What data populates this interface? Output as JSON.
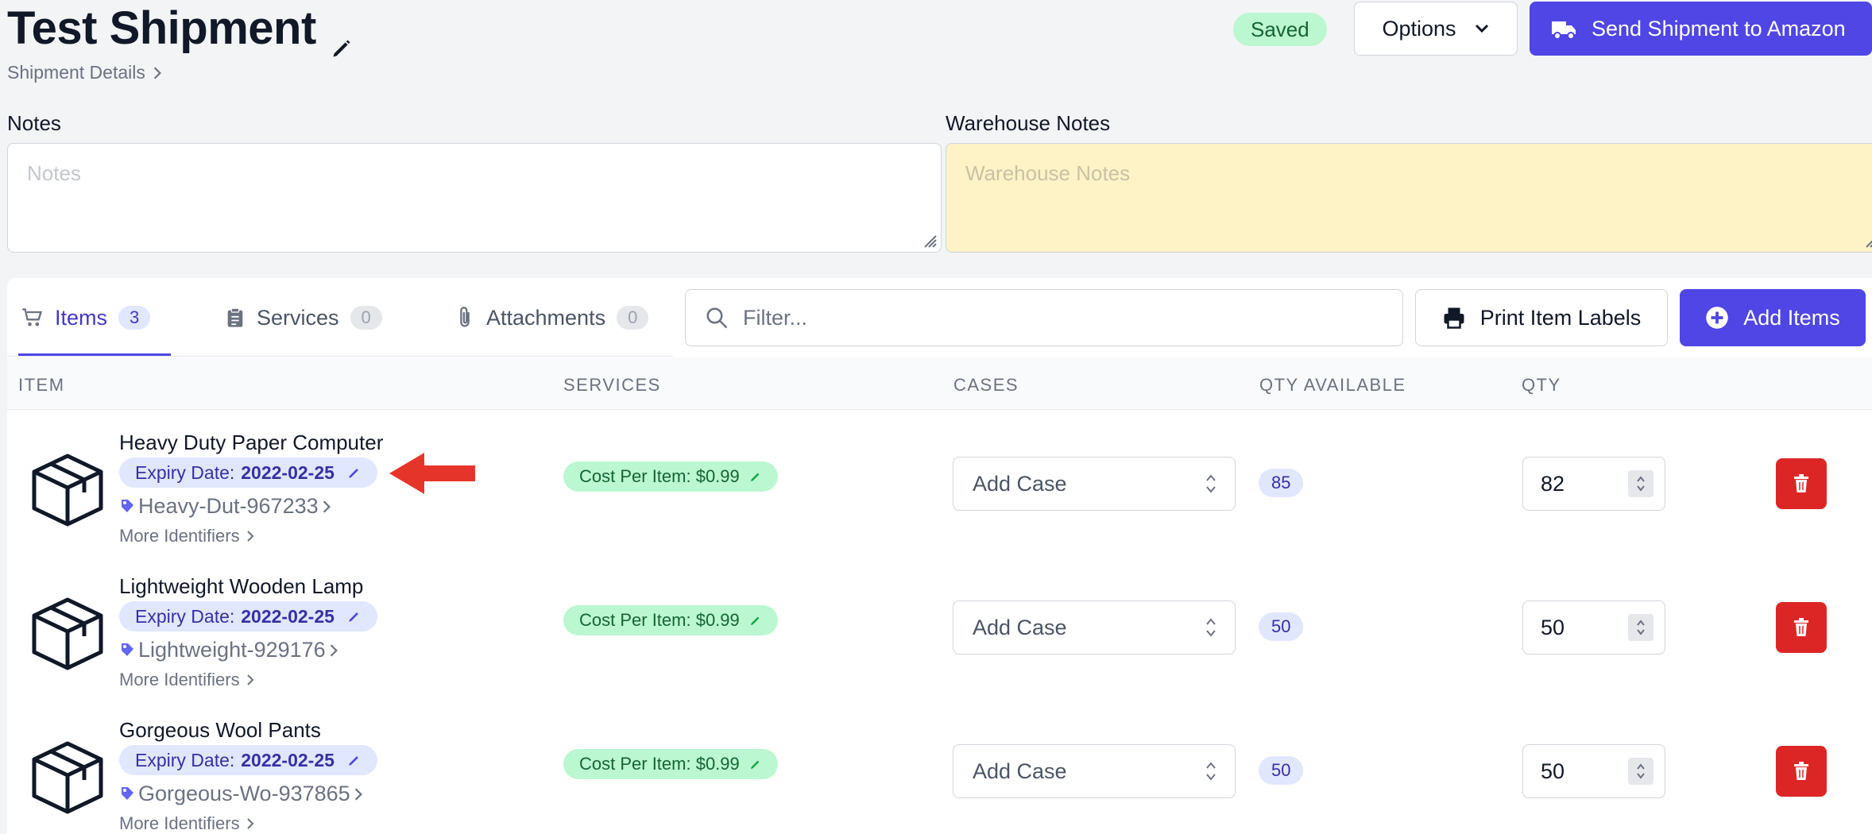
{
  "header": {
    "title": "Test Shipment",
    "breadcrumb": "Shipment Details",
    "status": "Saved",
    "options_label": "Options",
    "send_label": "Send Shipment to Amazon"
  },
  "notes": {
    "label": "Notes",
    "placeholder": "Notes",
    "value": ""
  },
  "warehouse_notes": {
    "label": "Warehouse Notes",
    "placeholder": "Warehouse Notes",
    "value": ""
  },
  "tabs": [
    {
      "label": "Items",
      "count": "3",
      "active": true
    },
    {
      "label": "Services",
      "count": "0",
      "active": false
    },
    {
      "label": "Attachments",
      "count": "0",
      "active": false
    }
  ],
  "filter": {
    "placeholder": "Filter..."
  },
  "actions": {
    "print_labels": "Print Item Labels",
    "add_items": "Add Items"
  },
  "table": {
    "columns": [
      "ITEM",
      "SERVICES",
      "CASES",
      "QTY AVAILABLE",
      "QTY"
    ],
    "rows": [
      {
        "name": "Heavy Duty Paper Computer",
        "expiry_label": "Expiry Date:",
        "expiry_date": "2022-02-25",
        "sku": "Heavy-Dut-967233",
        "more_identifiers": "More Identifiers",
        "service": "Cost Per Item: $0.99",
        "case_placeholder": "Add Case",
        "qty_available": "85",
        "qty": "82"
      },
      {
        "name": "Lightweight Wooden Lamp",
        "expiry_label": "Expiry Date:",
        "expiry_date": "2022-02-25",
        "sku": "Lightweight-929176",
        "more_identifiers": "More Identifiers",
        "service": "Cost Per Item: $0.99",
        "case_placeholder": "Add Case",
        "qty_available": "50",
        "qty": "50"
      },
      {
        "name": "Gorgeous Wool Pants",
        "expiry_label": "Expiry Date:",
        "expiry_date": "2022-02-25",
        "sku": "Gorgeous-Wo-937865",
        "more_identifiers": "More Identifiers",
        "service": "Cost Per Item: $0.99",
        "case_placeholder": "Add Case",
        "qty_available": "50",
        "qty": "50"
      }
    ]
  },
  "colors": {
    "accent": "#4f46e5",
    "danger": "#dc2626",
    "success_bg": "#bbf7d0",
    "warehouse_bg": "#fef3c7",
    "annotation_arrow": "#e5352b"
  },
  "icons": [
    "pencil-icon",
    "chevron-right-icon",
    "chevron-down-icon",
    "truck-icon",
    "cart-icon",
    "clipboard-icon",
    "paperclip-icon",
    "search-icon",
    "printer-icon",
    "plus-circle-icon",
    "box-icon",
    "tag-icon",
    "select-arrows-icon",
    "trash-icon"
  ]
}
